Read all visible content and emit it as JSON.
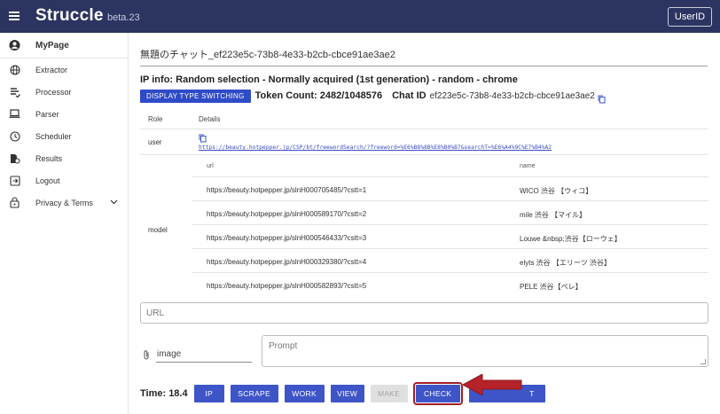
{
  "app": {
    "brand": "Struccle",
    "version": "beta.23",
    "userid_label": "UserID"
  },
  "sidebar": {
    "items": [
      {
        "label": "MyPage",
        "icon": "account-circle-icon"
      },
      {
        "label": "Extractor",
        "icon": "globe-icon"
      },
      {
        "label": "Processor",
        "icon": "processor-icon"
      },
      {
        "label": "Parser",
        "icon": "laptop-icon"
      },
      {
        "label": "Scheduler",
        "icon": "clock-icon"
      },
      {
        "label": "Results",
        "icon": "results-icon"
      },
      {
        "label": "Logout",
        "icon": "logout-icon"
      },
      {
        "label": "Privacy & Terms",
        "icon": "lock-icon"
      }
    ]
  },
  "chat": {
    "title": "無題のチャット_ef223e5c-73b8-4e33-b2cb-cbce91ae3ae2",
    "ip_info": "IP info: Random selection - Normally acquired (1st generation) - random - chrome",
    "display_button": "DISPLAY TYPE SWITCHING",
    "token_count": "Token Count: 2482/1048576",
    "chat_id_label": "Chat ID",
    "chat_id_value": "ef223e5c-73b8-4e33-b2cb-cbce91ae3ae2"
  },
  "table": {
    "headers": {
      "role": "Role",
      "details": "Details"
    },
    "user": {
      "role": "user",
      "link": "https://beauty.hotpepper.jp/CSP/bt/freewordSearch/?freeword=%E6%B8%8B%E8%B0%B7&searchT=%E6%A4%9C%E7%B4%A2"
    },
    "model": {
      "role": "model",
      "inner_headers": {
        "url": "url",
        "name": "name"
      },
      "rows": [
        {
          "url": "https://beauty.hotpepper.jp/slnH000705485/?cstt=1",
          "name": "WICO 渋谷 【ウィコ】"
        },
        {
          "url": "https://beauty.hotpepper.jp/slnH000589170/?cstt=2",
          "name": "mile 渋谷 【マイル】"
        },
        {
          "url": "https://beauty.hotpepper.jp/slnH000546433/?cstt=3",
          "name": "Louwe &nbsp;渋谷【ローウェ】"
        },
        {
          "url": "https://beauty.hotpepper.jp/slnH000329380/?cstt=4",
          "name": "elyts 渋谷 【エリーツ 渋谷】"
        },
        {
          "url": "https://beauty.hotpepper.jp/slnH000582893/?cstt=5",
          "name": "PELE 渋谷【ペレ】"
        }
      ]
    }
  },
  "inputs": {
    "url_placeholder": "URL",
    "image_label": "image",
    "prompt_placeholder": "Prompt"
  },
  "actions": {
    "time": "Time: 18.4",
    "ip": "IP",
    "scrape": "SCRAPE",
    "work": "WORK",
    "view": "VIEW",
    "make": "MAKE",
    "check": "CHECK",
    "last_partial": "T"
  },
  "colors": {
    "appbar": "#2c3561",
    "primary_button": "#3e55c8",
    "highlight": "#a21f24"
  }
}
